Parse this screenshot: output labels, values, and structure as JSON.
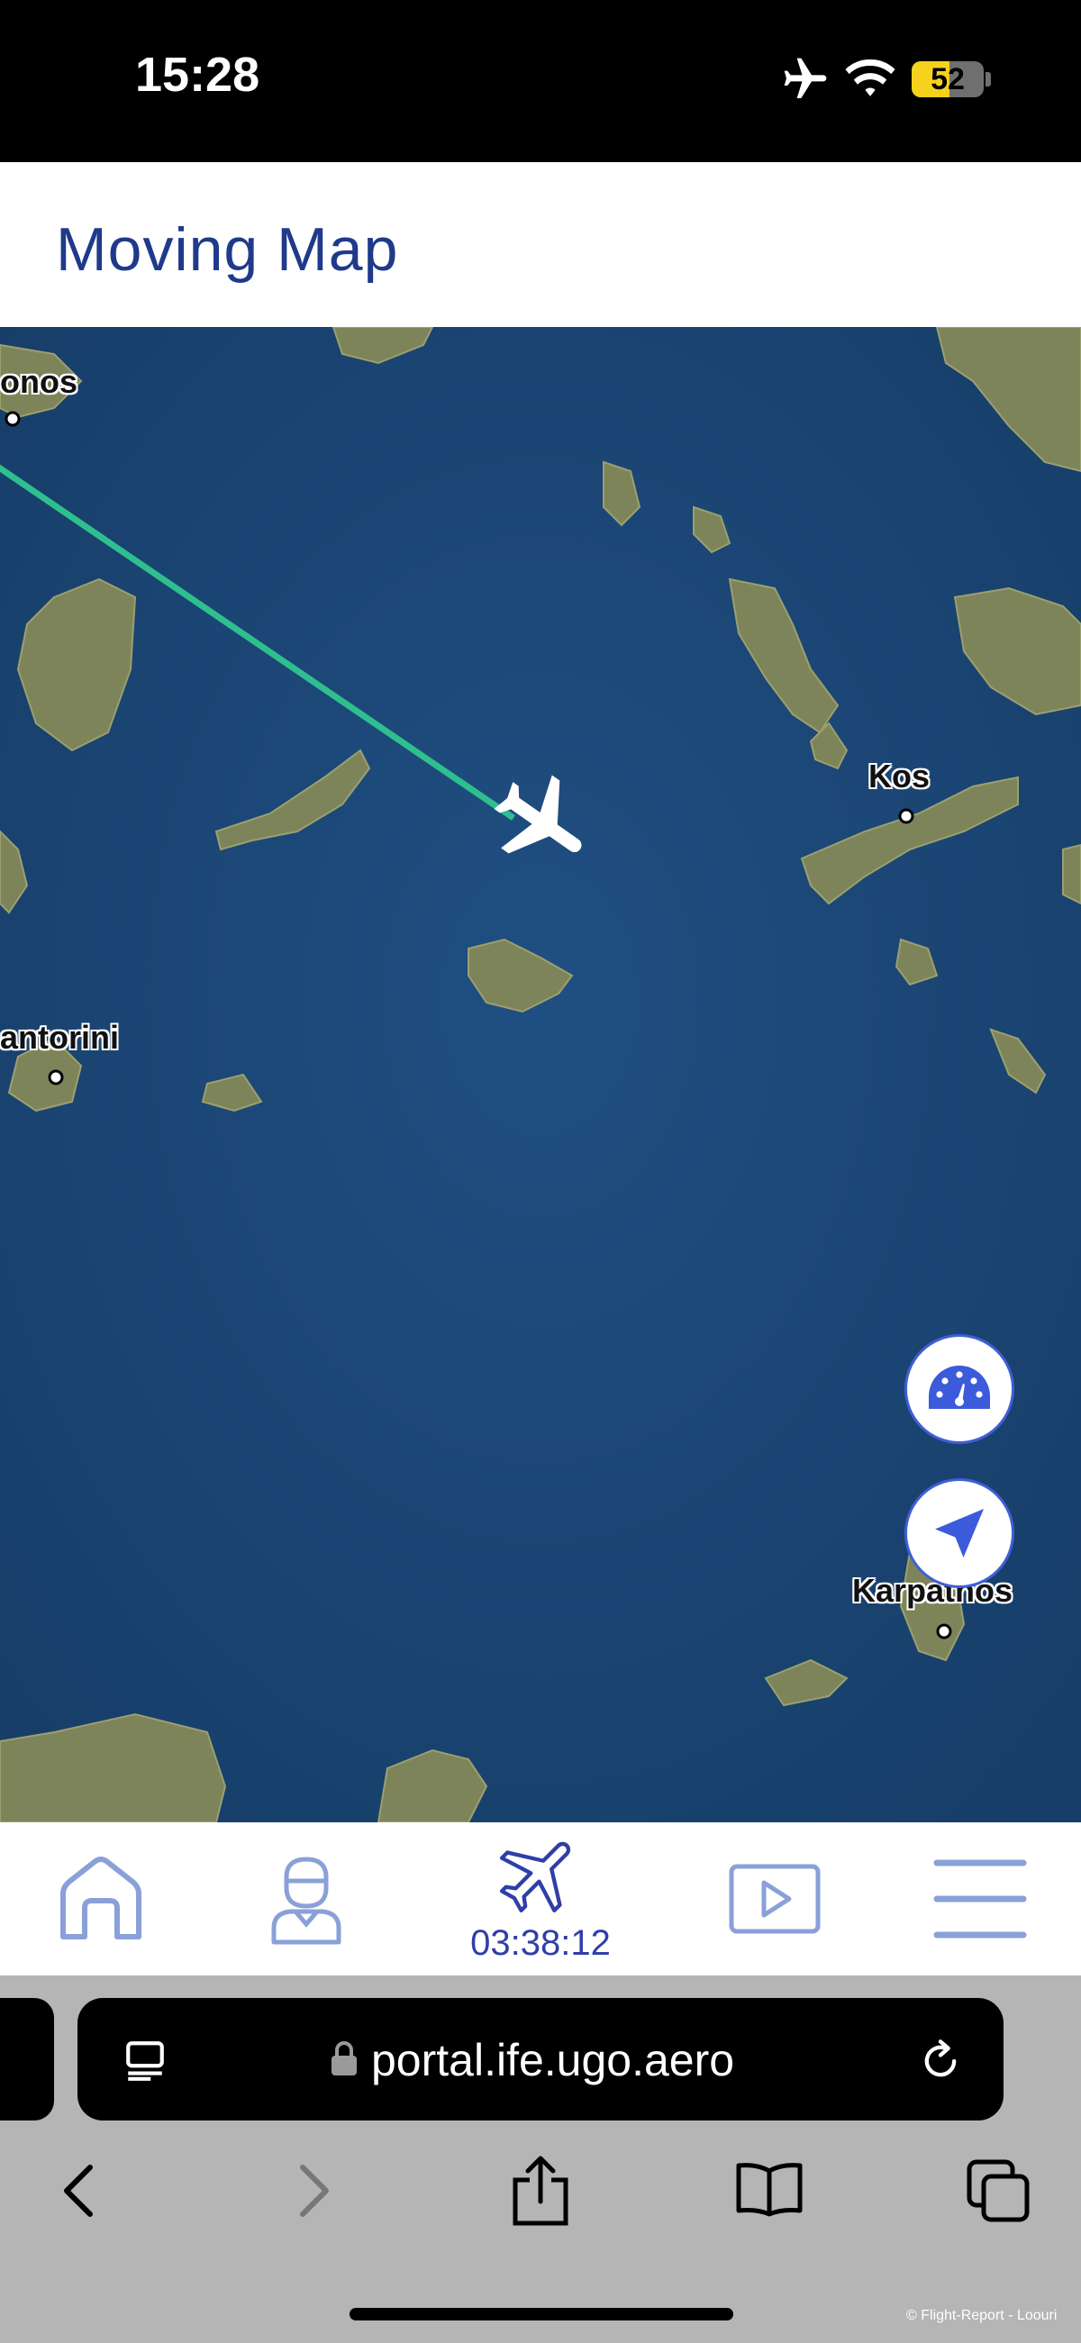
{
  "status_bar": {
    "time": "15:28",
    "battery": "52",
    "battery_fill_percent": 52,
    "icons": [
      "airplane-mode-icon",
      "wifi-icon",
      "battery-icon"
    ]
  },
  "header": {
    "title": "Moving Map"
  },
  "map": {
    "labels": {
      "mykonos": "onos",
      "kos": "Kos",
      "santorini": "antorini",
      "karpathos": "Karpathos"
    },
    "buttons": [
      "speedometer-icon",
      "navigation-arrow-icon"
    ],
    "colors": {
      "sea": "#1f4a7a",
      "route": "#2fbf8f",
      "land": "#8a8f5e"
    }
  },
  "bottom_nav": {
    "items": [
      "home-icon",
      "crew-icon",
      "flight-icon",
      "play-icon",
      "menu-icon"
    ],
    "flight_time": "03:38:12",
    "accent_color": "#2f3fa8"
  },
  "browser": {
    "url": "portal.ife.ugo.aero",
    "icons": [
      "reader-icon",
      "lock-icon",
      "reload-icon",
      "back-icon",
      "forward-icon",
      "share-icon",
      "bookmarks-icon",
      "tabs-icon"
    ]
  },
  "watermark": "© Flight-Report - Loouri"
}
